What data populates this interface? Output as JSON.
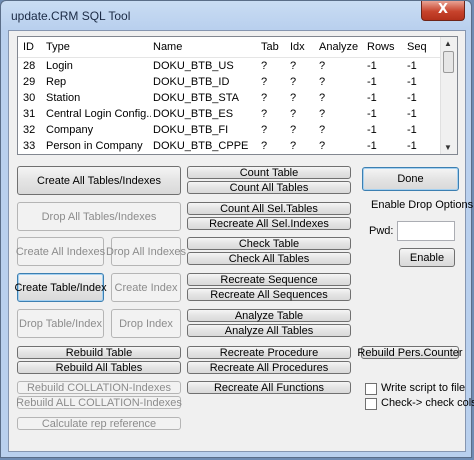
{
  "window": {
    "title": "update.CRM SQL Tool",
    "close_glyph": "X"
  },
  "list": {
    "columns": [
      "ID",
      "Type",
      "Name",
      "Tab",
      "Idx",
      "Analyze",
      "Rows",
      "Seq"
    ],
    "rows": [
      [
        "28",
        "Login",
        "DOKU_BTB_US",
        "?",
        "?",
        "?",
        "-1",
        "-1"
      ],
      [
        "29",
        "Rep",
        "DOKU_BTB_ID",
        "?",
        "?",
        "?",
        "-1",
        "-1"
      ],
      [
        "30",
        "Station",
        "DOKU_BTB_STA",
        "?",
        "?",
        "?",
        "-1",
        "-1"
      ],
      [
        "31",
        "Central Login Config...",
        "DOKU_BTB_ES",
        "?",
        "?",
        "?",
        "-1",
        "-1"
      ],
      [
        "32",
        "Company",
        "DOKU_BTB_FI",
        "?",
        "?",
        "?",
        "-1",
        "-1"
      ],
      [
        "33",
        "Person in Company",
        "DOKU_BTB_CPPE",
        "?",
        "?",
        "?",
        "-1",
        "-1"
      ]
    ]
  },
  "buttons": {
    "create_all_tables": "Create All Tables/Indexes",
    "drop_all_tables": "Drop All Tables/Indexes",
    "create_all_indexes": "Create All Indexes",
    "drop_all_indexes": "Drop All Indexes",
    "create_table_index": "Create Table/Index",
    "create_index": "Create Index",
    "drop_table_index": "Drop Table/Index",
    "drop_index": "Drop Index",
    "rebuild_table": "Rebuild Table",
    "rebuild_all_tables": "Rebuild All Tables",
    "rebuild_collation": "Rebuild COLLATION-Indexes",
    "rebuild_all_collation": "Rebuild ALL COLLATION-Indexes",
    "calculate_rep_reference": "Calculate rep reference",
    "count_table": "Count Table",
    "count_all_tables": "Count All Tables",
    "count_all_sel_tables": "Count All Sel.Tables",
    "recreate_all_sel_indexes": "Recreate All Sel.Indexes",
    "check_table": "Check Table",
    "check_all_tables": "Check All Tables",
    "recreate_sequence": "Recreate Sequence",
    "recreate_all_sequences": "Recreate All Sequences",
    "analyze_table": "Analyze Table",
    "analyze_all_tables": "Analyze All Tables",
    "recreate_procedure": "Recreate Procedure",
    "recreate_all_procedures": "Recreate All Procedures",
    "recreate_all_functions": "Recreate All Functions",
    "done": "Done",
    "enable": "Enable",
    "rebuild_pers_counter": "Rebuild Pers.Counter"
  },
  "drop_options": {
    "label": "Enable Drop Options",
    "pwd_label": "Pwd:",
    "pwd_value": ""
  },
  "checkboxes": {
    "write_script": {
      "label": "Write script to file",
      "checked": false
    },
    "check_cols": {
      "label": "Check-> check cols.",
      "checked": false
    }
  }
}
